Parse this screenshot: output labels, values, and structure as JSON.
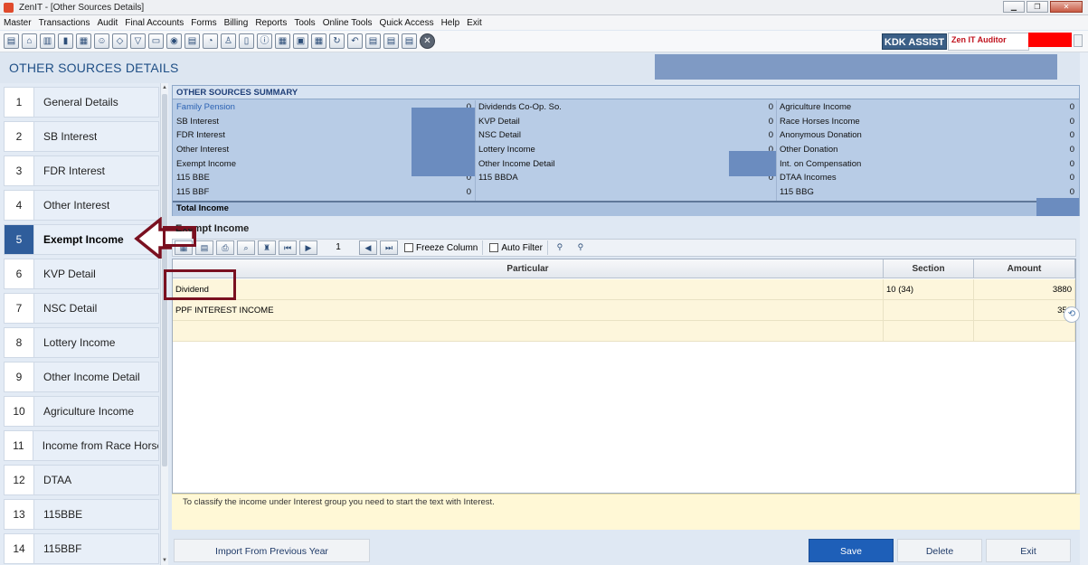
{
  "window": {
    "title": "ZenIT - [Other Sources Details]"
  },
  "menu": [
    "Master",
    "Transactions",
    "Audit",
    "Final Accounts",
    "Forms",
    "Billing",
    "Reports",
    "Tools",
    "Online Tools",
    "Quick Access",
    "Help",
    "Exit"
  ],
  "toolbar": {
    "icons": [
      "folder-icon",
      "home-icon",
      "building-icon",
      "chart-icon",
      "calendar-icon",
      "users-icon",
      "tag-icon",
      "filter-icon",
      "save-icon",
      "media-icon",
      "document-icon",
      "pie-icon",
      "user-icon",
      "book-icon",
      "info-icon",
      "table-icon",
      "image-icon",
      "calendar-icon",
      "refresh-icon",
      "back-icon",
      "bs-icon",
      "sod-icon",
      "report-icon",
      "close-icon"
    ],
    "kdk_label": "KDK ASSIST",
    "auditor_label": "Zen IT Auditor"
  },
  "page": {
    "title": "OTHER SOURCES DETAILS"
  },
  "sidebar": {
    "items": [
      {
        "num": "1",
        "label": "General Details"
      },
      {
        "num": "2",
        "label": "SB Interest"
      },
      {
        "num": "3",
        "label": "FDR Interest"
      },
      {
        "num": "4",
        "label": "Other Interest"
      },
      {
        "num": "5",
        "label": "Exempt Income"
      },
      {
        "num": "6",
        "label": "KVP Detail"
      },
      {
        "num": "7",
        "label": "NSC Detail"
      },
      {
        "num": "8",
        "label": "Lottery Income"
      },
      {
        "num": "9",
        "label": "Other Income Detail"
      },
      {
        "num": "10",
        "label": "Agriculture Income"
      },
      {
        "num": "11",
        "label": "Income from Race Horse"
      },
      {
        "num": "12",
        "label": "DTAA"
      },
      {
        "num": "13",
        "label": "115BBE"
      },
      {
        "num": "14",
        "label": "115BBF"
      }
    ],
    "active_index": 4
  },
  "summary": {
    "heading": "OTHER SOURCES SUMMARY",
    "col1": [
      {
        "label": "Family Pension",
        "value": "0"
      },
      {
        "label": "SB Interest",
        "value": ""
      },
      {
        "label": "FDR Interest",
        "value": ""
      },
      {
        "label": "Other Interest",
        "value": ""
      },
      {
        "label": "Exempt Income",
        "value": ""
      },
      {
        "label": "115 BBE",
        "value": "0"
      },
      {
        "label": "115 BBF",
        "value": "0"
      }
    ],
    "col2": [
      {
        "label": "Dividends Co-Op. So.",
        "value": "0"
      },
      {
        "label": "KVP Detail",
        "value": "0"
      },
      {
        "label": "NSC Detail",
        "value": "0"
      },
      {
        "label": "Lottery Income",
        "value": "0"
      },
      {
        "label": "Other Income Detail",
        "value": ""
      },
      {
        "label": "115 BBDA",
        "value": "0"
      },
      {
        "label": "",
        "value": ""
      }
    ],
    "col3": [
      {
        "label": "Agriculture Income",
        "value": "0"
      },
      {
        "label": "Race Horses Income",
        "value": "0"
      },
      {
        "label": "Anonymous Donation",
        "value": "0"
      },
      {
        "label": "Other Donation",
        "value": "0"
      },
      {
        "label": "Int. on Compensation",
        "value": "0"
      },
      {
        "label": "DTAA Incomes",
        "value": "0"
      },
      {
        "label": "115 BBG",
        "value": "0"
      }
    ],
    "total_label": "Total Income"
  },
  "exempt": {
    "section_label": "Exempt Income",
    "page_number": "1",
    "freeze_label": "Freeze Column",
    "auto_filter_label": "Auto Filter",
    "columns": [
      "Particular",
      "Section",
      "Amount"
    ],
    "rows": [
      {
        "particular": "Dividend",
        "section": "10 (34)",
        "amount": "3880"
      },
      {
        "particular": "PPF INTEREST INCOME",
        "section": "",
        "amount": "352"
      },
      {
        "particular": "",
        "section": "",
        "amount": ""
      }
    ],
    "hint": "To classify the income under Interest group you need to start the text with Interest."
  },
  "buttons": {
    "import": "Import From Previous Year",
    "save": "Save",
    "delete": "Delete",
    "exit": "Exit"
  },
  "colors": {
    "accent": "#1e5fb8",
    "annotation": "#7a1020",
    "summary_bg": "#b8cce6",
    "grid_row_bg": "#fdf6dc"
  }
}
